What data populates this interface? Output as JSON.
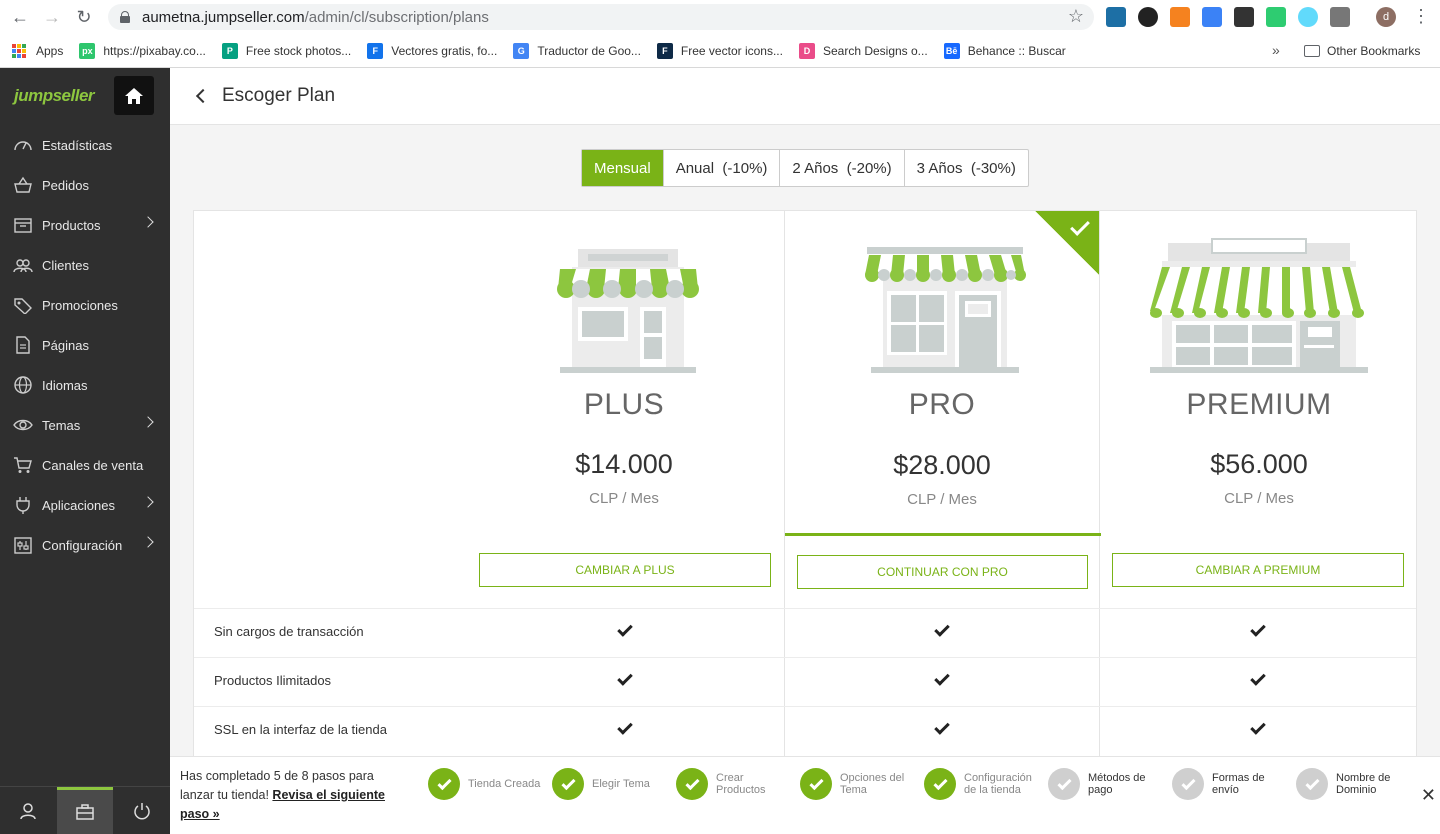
{
  "browser": {
    "url_host": "aumetna.jumpseller.com",
    "url_path": "/admin/cl/subscription/plans",
    "profile_initial": "d",
    "bookmarks": [
      {
        "label": "Apps",
        "color": "#4285f4"
      },
      {
        "label": "https://pixabay.co...",
        "color": "#2ec66d",
        "icon_text": "px"
      },
      {
        "label": "Free stock photos...",
        "color": "#05a081",
        "icon_text": "P"
      },
      {
        "label": "Vectores gratis, fo...",
        "color": "#1273eb",
        "icon_text": "F"
      },
      {
        "label": "Traductor de Goo...",
        "color": "#4285f4",
        "icon_text": "G"
      },
      {
        "label": "Free vector icons...",
        "color": "#0e2a47",
        "icon_text": "F"
      },
      {
        "label": "Search Designs o...",
        "color": "#ea4c89",
        "icon_text": "D"
      },
      {
        "label": "Behance :: Buscar",
        "color": "#1769ff",
        "icon_text": "Bē"
      }
    ],
    "other_bookmarks": "Other Bookmarks",
    "overflow": "»"
  },
  "sidebar": {
    "logo": "jumpseller",
    "items": [
      {
        "label": "Estadísticas",
        "icon": "speedometer-icon",
        "has_chevron": false
      },
      {
        "label": "Pedidos",
        "icon": "basket-icon",
        "has_chevron": false
      },
      {
        "label": "Productos",
        "icon": "box-icon",
        "has_chevron": true
      },
      {
        "label": "Clientes",
        "icon": "users-icon",
        "has_chevron": false
      },
      {
        "label": "Promociones",
        "icon": "tag-icon",
        "has_chevron": false
      },
      {
        "label": "Páginas",
        "icon": "page-icon",
        "has_chevron": false
      },
      {
        "label": "Idiomas",
        "icon": "globe-icon",
        "has_chevron": false
      },
      {
        "label": "Temas",
        "icon": "eye-icon",
        "has_chevron": true
      },
      {
        "label": "Canales de venta",
        "icon": "cart-icon",
        "has_chevron": false
      },
      {
        "label": "Aplicaciones",
        "icon": "plug-icon",
        "has_chevron": true
      },
      {
        "label": "Configuración",
        "icon": "settings-icon",
        "has_chevron": true
      }
    ]
  },
  "header": {
    "title": "Escoger Plan"
  },
  "billing_toggle": {
    "options": [
      "Mensual",
      "Anual  (-10%)",
      "2 Años  (-20%)",
      "3 Años  (-30%)"
    ],
    "selected": "Mensual"
  },
  "plans": [
    {
      "name": "PLUS",
      "price": "$14.000",
      "unit": "CLP / Mes",
      "button": "CAMBIAR A PLUS",
      "current": false
    },
    {
      "name": "PRO",
      "price": "$28.000",
      "unit": "CLP / Mes",
      "button": "CONTINUAR CON PRO",
      "current": true
    },
    {
      "name": "PREMIUM",
      "price": "$56.000",
      "unit": "CLP / Mes",
      "button": "CAMBIAR A PREMIUM",
      "current": false
    }
  ],
  "features": [
    {
      "label": "Sin cargos de transacción",
      "plus": true,
      "pro": true,
      "premium": true
    },
    {
      "label": "Productos Ilimitados",
      "plus": true,
      "pro": true,
      "premium": true
    },
    {
      "label": "SSL en la interfaz de la tienda",
      "plus": true,
      "pro": true,
      "premium": true
    }
  ],
  "onboarding": {
    "text_prefix": "Has completado 5 de 8 pasos para lanzar tu tienda! ",
    "link": "Revisa el siguiente paso »",
    "steps": [
      {
        "label": "Tienda Creada",
        "done": true
      },
      {
        "label": "Elegir Tema",
        "done": true
      },
      {
        "label": "Crear Productos",
        "done": true
      },
      {
        "label": "Opciones del Tema",
        "done": true
      },
      {
        "label": "Configuración de la tienda",
        "done": true
      },
      {
        "label": "Métodos de pago",
        "done": false
      },
      {
        "label": "Formas de envío",
        "done": false
      },
      {
        "label": "Nombre de Dominio",
        "done": false
      }
    ],
    "close": "✕"
  },
  "colors": {
    "accent": "#7ab317",
    "sidebar": "#2f2f2f"
  }
}
